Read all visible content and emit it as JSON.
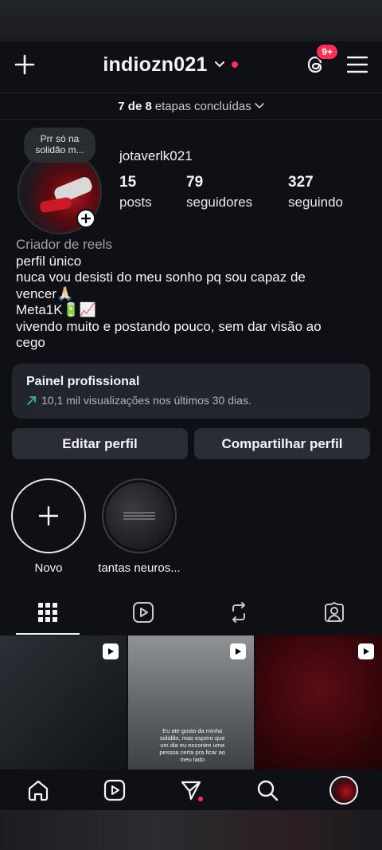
{
  "header": {
    "username": "indiozn021",
    "notification_badge": "9+"
  },
  "onboarding": {
    "steps_bold": "7 de 8",
    "steps_rest": "etapas concluídas"
  },
  "profile": {
    "note": "Prr só na solidão m...",
    "display_name": "jotaverlk021",
    "stats": [
      {
        "value": "15",
        "label": "posts"
      },
      {
        "value": "79",
        "label": "seguidores"
      },
      {
        "value": "327",
        "label": "seguindo"
      }
    ],
    "category": "Criador de reels",
    "bio_lines": [
      "perfil único",
      "nuca vou desisti do meu sonho pq sou capaz de",
      "vencer🙏🏻",
      "Meta1K🔋📈",
      "vivendo muito e postando pouco, sem dar visão ao",
      "cego"
    ]
  },
  "professional_panel": {
    "title": "Painel profissional",
    "subtitle": "10,1 mil visualizações nos últimos 30 dias."
  },
  "actions": {
    "edit_profile": "Editar perfil",
    "share_profile": "Compartilhar perfil"
  },
  "highlights": [
    {
      "label": "Novo"
    },
    {
      "label": "tantas neuros..."
    }
  ],
  "tabs": [
    "grid",
    "reels",
    "reposts",
    "tagged"
  ],
  "posts": [
    {
      "type": "reel",
      "caption": ""
    },
    {
      "type": "reel",
      "caption": "Eu ate gosto da minha solidão, mas espero que um dia eu encontre uma pessoa certa pra ficar ao meu lado"
    },
    {
      "type": "reel",
      "caption": ""
    }
  ],
  "bottom_nav": [
    "home",
    "reels",
    "direct",
    "search",
    "profile"
  ],
  "colors": {
    "background": "#0e1016",
    "accent_red": "#ff2d55",
    "trend_green": "#37c16e",
    "button_bg": "#2a2d35"
  }
}
